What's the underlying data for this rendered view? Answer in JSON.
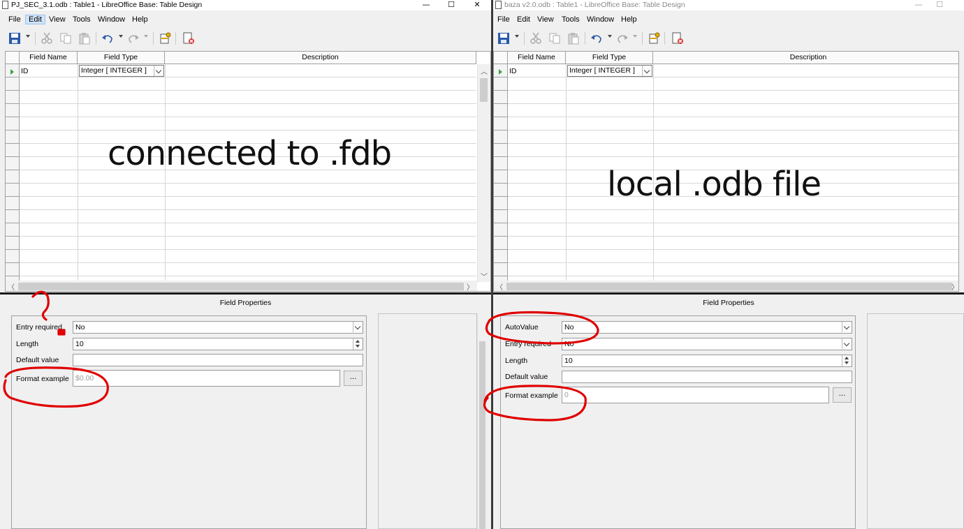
{
  "left_window": {
    "title": "PJ_SEC_3.1.odb : Table1 - LibreOffice Base: Table Design",
    "menu": [
      "File",
      "Edit",
      "View",
      "Tools",
      "Window",
      "Help"
    ],
    "columns": [
      "Field Name",
      "Field Type",
      "Description"
    ],
    "row": {
      "field_name": "ID",
      "field_type": "Integer [ INTEGER ]"
    },
    "overlay_text": "connected to .fdb",
    "properties_title": "Field Properties",
    "properties": [
      {
        "label": "Entry required",
        "value": "No"
      },
      {
        "label": "Length",
        "value": "10"
      },
      {
        "label": "Default value",
        "value": ""
      },
      {
        "label": "Format example",
        "value": "$0.00"
      }
    ],
    "dots_label": "...",
    "annotation_mark": "?"
  },
  "right_window": {
    "title": "baza v2.0.odb : Table1 - LibreOffice Base: Table Design",
    "menu": [
      "File",
      "Edit",
      "View",
      "Tools",
      "Window",
      "Help"
    ],
    "columns": [
      "Field Name",
      "Field Type",
      "Description"
    ],
    "row": {
      "field_name": "ID",
      "field_type": "Integer [ INTEGER ]"
    },
    "overlay_text": "local .odb file",
    "properties_title": "Field Properties",
    "properties": [
      {
        "label": "AutoValue",
        "value": "No"
      },
      {
        "label": "Entry required",
        "value": "No"
      },
      {
        "label": "Length",
        "value": "10"
      },
      {
        "label": "Default value",
        "value": ""
      },
      {
        "label": "Format example",
        "value": "0"
      }
    ],
    "dots_label": "..."
  },
  "window_controls": {
    "minimize": "—",
    "maximize": "☐",
    "close": "✕"
  },
  "colors": {
    "annotation": "#e00000",
    "row_marker": "#3ea33e",
    "menu_active": "#cfe3fa"
  },
  "toolbar_icons": [
    "save-icon",
    "cut-icon",
    "copy-icon",
    "paste-icon",
    "undo-icon",
    "redo-icon",
    "primary-key-icon",
    "close-document-icon"
  ]
}
